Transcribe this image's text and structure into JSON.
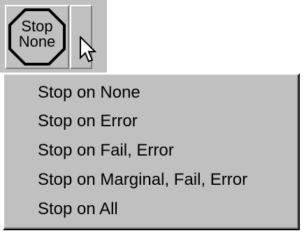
{
  "toolbar": {
    "stop_button": {
      "icon": "stop-octagon-icon",
      "label_line1": "Stop",
      "label_line2": "None"
    },
    "dropdown_arrow": {
      "icon": "dropdown-arrow-icon"
    }
  },
  "cursor": {
    "icon": "mouse-pointer-icon"
  },
  "menu": {
    "items": [
      {
        "label": "Stop on None"
      },
      {
        "label": "Stop on Error"
      },
      {
        "label": "Stop on Fail, Error"
      },
      {
        "label": "Stop on Marginal, Fail, Error"
      },
      {
        "label": "Stop on All"
      }
    ]
  },
  "colors": {
    "face": "#c0c0c0",
    "highlight": "#ffffff",
    "shadow": "#808080",
    "dark_shadow": "#000000",
    "text": "#000000"
  }
}
